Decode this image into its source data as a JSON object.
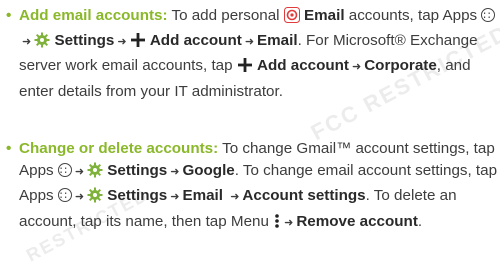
{
  "watermark": [
    "FCC RESTRICTED",
    "RESTRICTED"
  ],
  "item1": {
    "bullet": "•",
    "lead": "Add email accounts:",
    "t1": " To add personal ",
    "email_label": "Email",
    "t2": " accounts, tap Apps ",
    "settings_label": "Settings",
    "add_account_label": "Add account",
    "email2_label": "Email",
    "t3": ". For Microsoft® Exchange server work email accounts, tap ",
    "add_account2_label": "Add account",
    "corporate_label": "Corporate",
    "t4": ", and enter details from your IT administrator."
  },
  "item2": {
    "bullet": "•",
    "lead": "Change or delete accounts:",
    "t1": " To change Gmail™ account settings, tap Apps ",
    "settings_label": "Settings",
    "google_label": "Google",
    "t2": ". To change email account settings, tap Apps ",
    "settings2_label": "Settings",
    "email_label": "Email",
    "account_settings_label": "Account settings",
    "t3": ". To delete an account, tap its name, then tap Menu ",
    "remove_account_label": "Remove account",
    "t4": "."
  },
  "colors": {
    "accent": "#8ab82a",
    "text": "#3d3d3d",
    "email_icon": "#e23b3b"
  },
  "icons": [
    "email-icon",
    "apps-icon",
    "settings-gear-icon",
    "add-plus-icon",
    "menu-icon",
    "arrow-icon"
  ]
}
